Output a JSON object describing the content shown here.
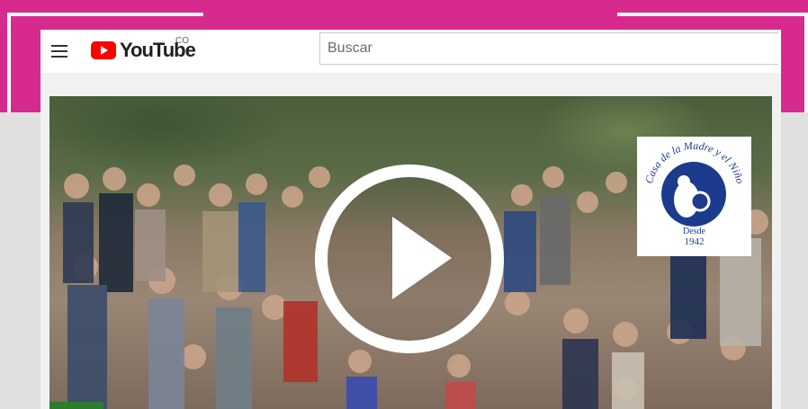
{
  "frame": {
    "color": "#d62a8e"
  },
  "header": {
    "menu_icon": "hamburger-menu-icon",
    "logo_text": "YouTube",
    "country_code": "CO",
    "search_placeholder": "Buscar"
  },
  "video": {
    "play_icon": "play-icon",
    "overlay_logo": {
      "arc_text": "Casa de la Madre y el Niño",
      "since_label": "Desde",
      "since_year": "1942",
      "brand_color": "#1d3b8c"
    }
  }
}
